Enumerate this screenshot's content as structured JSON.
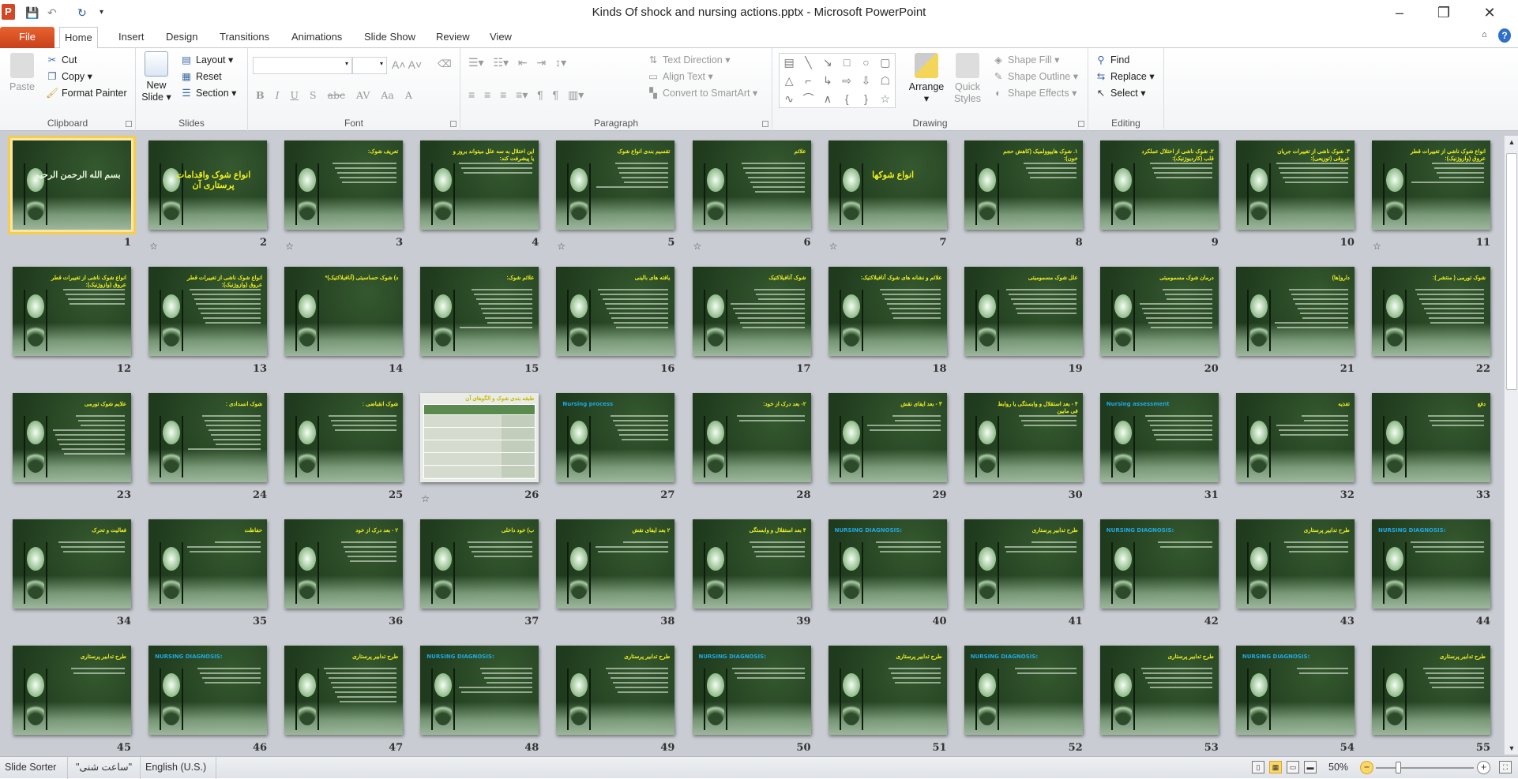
{
  "window": {
    "title": "Kinds Of shock and nursing actions.pptx - Microsoft PowerPoint",
    "app_icon": "P",
    "minimize": "–",
    "restore": "❐",
    "close": "✕"
  },
  "quick_access": {
    "save_icon": "save-icon",
    "undo_icon": "undo-icon",
    "redo_icon": "redo-icon",
    "customize_icon": "chevron-down-icon"
  },
  "tabs": [
    {
      "label": "File"
    },
    {
      "label": "Home",
      "active": true
    },
    {
      "label": "Insert"
    },
    {
      "label": "Design"
    },
    {
      "label": "Transitions"
    },
    {
      "label": "Animations"
    },
    {
      "label": "Slide Show"
    },
    {
      "label": "Review"
    },
    {
      "label": "View"
    }
  ],
  "ribbon": {
    "clipboard": {
      "label": "Clipboard",
      "paste": "Paste",
      "cut": "Cut",
      "copy": "Copy",
      "format_painter": "Format Painter"
    },
    "slides": {
      "label": "Slides",
      "new_slide": "New Slide",
      "layout": "Layout",
      "reset": "Reset",
      "section": "Section"
    },
    "font": {
      "label": "Font",
      "font_name": "",
      "font_size": ""
    },
    "paragraph": {
      "label": "Paragraph",
      "text_direction": "Text Direction",
      "align_text": "Align Text",
      "convert_smartart": "Convert to SmartArt"
    },
    "drawing": {
      "label": "Drawing",
      "arrange": "Arrange",
      "quick_styles": "Quick Styles",
      "shape_fill": "Shape Fill",
      "shape_outline": "Shape Outline",
      "shape_effects": "Shape Effects"
    },
    "editing": {
      "label": "Editing",
      "find": "Find",
      "replace": "Replace",
      "select": "Select"
    }
  },
  "slides": [
    {
      "num": "1",
      "title": "بسم الله الرحمن الرحيم",
      "style": "big wh",
      "selected": true
    },
    {
      "num": "2",
      "title": "انواع شوک واقدامات پرستاری آن",
      "style": "big",
      "anim": true
    },
    {
      "num": "3",
      "title": "تعریف شوک:",
      "anim": true,
      "body": 5
    },
    {
      "num": "4",
      "title": "این اختلال به سه علل میتواند بروز و یا پیشرفت کند:",
      "body": 3
    },
    {
      "num": "5",
      "title": "تقسیم بندی انواع شوک",
      "anim": true,
      "body": 6
    },
    {
      "num": "6",
      "title": "علائم",
      "anim": true,
      "body": 7
    },
    {
      "num": "7",
      "title": "انواع شوکها",
      "style": "big",
      "anim": true
    },
    {
      "num": "8",
      "title": "۱. شوک هایپوولمیک (کاهش حجم خون):",
      "body": 4
    },
    {
      "num": "9",
      "title": "۲. شوک ناشی از اختلال عملکرد قلب (کاردیوژنیک):",
      "body": 4
    },
    {
      "num": "10",
      "title": "۳. شوک ناشی از تغییرات جریان عروقی (توزیعی):",
      "body": 5
    },
    {
      "num": "11",
      "title": "انواع شوک ناشی از تغییرات قطر عروق (وازوژنیک):",
      "anim": true,
      "body": 5
    },
    {
      "num": "12",
      "title": "انواع شوک ناشی از تغییرات قطر عروق (وازوژنیک):",
      "body": 4
    },
    {
      "num": "13",
      "title": "انواع شوک ناشی از تغییرات قطر عروق (وازوژنیک):",
      "body": 8
    },
    {
      "num": "14",
      "title": "د) شوک حساسیتی (آنافیلاکتیک)*"
    },
    {
      "num": "15",
      "title": "علائم شوک:",
      "body": 9
    },
    {
      "num": "16",
      "title": "یافته های بالینی",
      "body": 9
    },
    {
      "num": "17",
      "title": "شوک آنافیلاکتیک",
      "body": 9
    },
    {
      "num": "18",
      "title": "علائم و نشانه های شوک آنافیلاکتیک:",
      "body": 7
    },
    {
      "num": "19",
      "title": "علل شوک مسمومیتی",
      "body": 6
    },
    {
      "num": "20",
      "title": "درمان شوک مسمومیتی",
      "body": 9
    },
    {
      "num": "21",
      "title": "دارو(ها)",
      "body": 9
    },
    {
      "num": "22",
      "title": "شوک تورمی ( منتشر ):",
      "body": 8
    },
    {
      "num": "23",
      "title": "علایم شوک تورمی",
      "body": 9
    },
    {
      "num": "24",
      "title": "شوک انسدادی :",
      "body": 8
    },
    {
      "num": "25",
      "title": "شوک انقباضی :",
      "body": 4
    },
    {
      "num": "26",
      "title": "طبقه بندی شوک و الگوهای آن",
      "style": "table",
      "anim": true
    },
    {
      "num": "27",
      "title": "Nursing process",
      "style": "en",
      "body": 6
    },
    {
      "num": "28",
      "title": "۲- بعد درک از خود:",
      "body": 2
    },
    {
      "num": "29",
      "title": "۳ - بعد ایفای نقش",
      "body": 4
    },
    {
      "num": "30",
      "title": "۴ - بعد استقلال و وابستگی یا روابط فی مابین",
      "body": 3
    },
    {
      "num": "31",
      "title": "Nursing assessment",
      "style": "en",
      "body": 6
    },
    {
      "num": "32",
      "title": "تغذیه",
      "body": 5
    },
    {
      "num": "33",
      "title": "دفع",
      "body": 3
    },
    {
      "num": "34",
      "title": "فعالیت و تحرک",
      "body": 3
    },
    {
      "num": "35",
      "title": "حفاظت",
      "body": 3
    },
    {
      "num": "36",
      "title": "۲ - بعد درک از خود",
      "body": 5
    },
    {
      "num": "37",
      "title": "ب) خود داخلی",
      "body": 4
    },
    {
      "num": "38",
      "title": "۲ بعد ایفای نقش",
      "body": 3
    },
    {
      "num": "39",
      "title": "۴ بعد استقلال و وابستگی",
      "body": 4
    },
    {
      "num": "40",
      "title": "NURSING DIAGNOSIS:",
      "style": "en",
      "body": 3
    },
    {
      "num": "41",
      "title": "طرح تدابیر پرستاری",
      "body": 3
    },
    {
      "num": "42",
      "title": "NURSING DIAGNOSIS:",
      "style": "en",
      "body": 2
    },
    {
      "num": "43",
      "title": "طرح تدابیر پرستاری",
      "body": 3
    },
    {
      "num": "44",
      "title": "NURSING DIAGNOSIS:",
      "style": "en",
      "body": 3
    },
    {
      "num": "45",
      "title": "طرح تدابیر پرستاری",
      "body": 2
    },
    {
      "num": "46",
      "title": "NURSING DIAGNOSIS:",
      "style": "en",
      "body": 4
    },
    {
      "num": "47",
      "title": "طرح تدابیر پرستاری",
      "body": 8
    },
    {
      "num": "48",
      "title": "NURSING DIAGNOSIS:",
      "style": "en",
      "body": 6
    },
    {
      "num": "49",
      "title": "طرح تدابیر پرستاری",
      "body": 6
    },
    {
      "num": "50",
      "title": "NURSING DIAGNOSIS:",
      "style": "en",
      "body": 3
    },
    {
      "num": "51",
      "title": "طرح تدابیر پرستاری",
      "body": 4
    },
    {
      "num": "52",
      "title": "NURSING DIAGNOSIS:",
      "style": "en",
      "body": 2
    },
    {
      "num": "53",
      "title": "طرح تدابیر پرستاری",
      "body": 5
    },
    {
      "num": "54",
      "title": "NURSING DIAGNOSIS:",
      "style": "en",
      "body": 2
    },
    {
      "num": "55",
      "title": "طرح تدابیر پرستاری",
      "body": 5
    }
  ],
  "status": {
    "view": "Slide Sorter",
    "theme": "\"ساعت شنی\"",
    "language": "English (U.S.)",
    "zoom": "50%",
    "zoom_percent": 50
  },
  "colors": {
    "slide_title": "#f0f020",
    "nursing_title": "#20a8e0",
    "selection": "#f5cc4f",
    "file_tab": "#d24726"
  }
}
